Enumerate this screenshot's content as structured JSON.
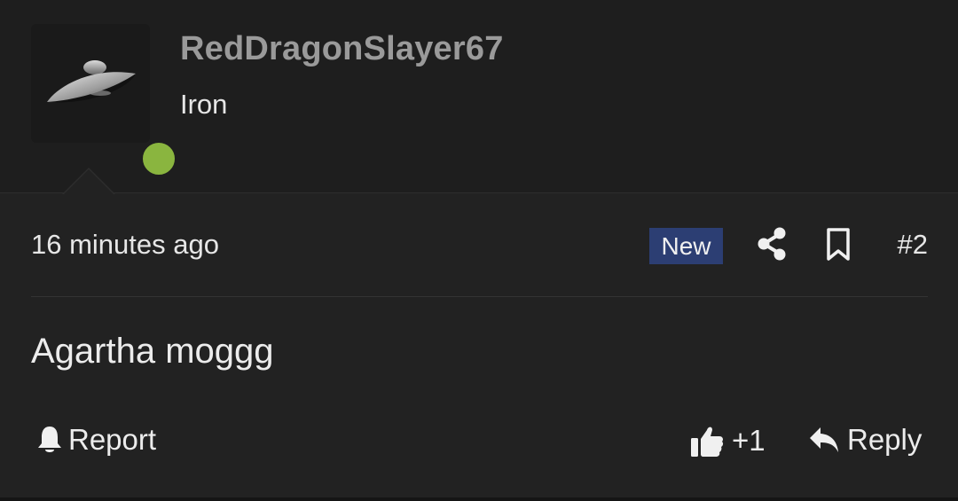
{
  "post": {
    "author": {
      "username": "RedDragonSlayer67",
      "rank": "Iron",
      "online": true,
      "avatar_icon": "ufo-icon"
    },
    "timestamp": "16 minutes ago",
    "badge": "New",
    "post_number": "#2",
    "content": "Agartha moggg",
    "actions": {
      "report_label": "Report",
      "like_label": "+1",
      "reply_label": "Reply"
    }
  },
  "colors": {
    "background": "#222222",
    "header_background": "#1e1e1e",
    "username": "#9a9a9a",
    "online_dot": "#8ab53f",
    "new_badge": "#2c3e73",
    "text": "#e6e6e6"
  }
}
